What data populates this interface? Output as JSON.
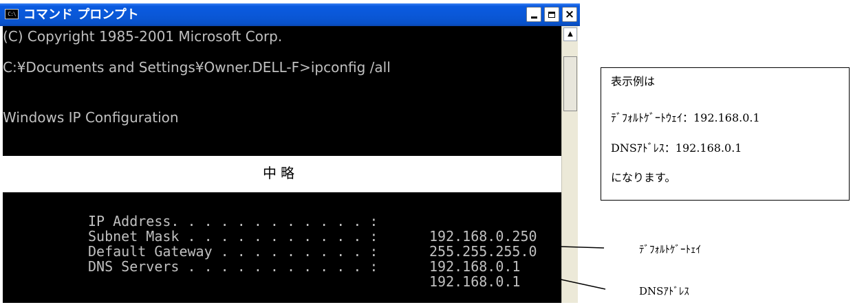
{
  "window": {
    "title": "コマンド プロンプト",
    "app_icon_text": "C:\\",
    "buttons": {
      "minimize": "minimize",
      "maximize": "maximize",
      "close": "×"
    }
  },
  "console": {
    "lines": [
      "(C) Copyright 1985-2001 Microsoft Corp.",
      "C:¥Documents and Settings¥Owner.DELL-F>ipconfig /all",
      "Windows IP Configuration"
    ],
    "omitted_label": "中略",
    "config_rows": [
      {
        "label": "IP Address. . . . . . . . . . . . :",
        "value": "192.168.0.250"
      },
      {
        "label": "Subnet Mask . . . . . . . . . . . :",
        "value": "255.255.255.0"
      },
      {
        "label": "Default Gateway . . . . . . . . . :",
        "value": "192.168.0.1"
      },
      {
        "label": "DNS Servers . . . . . . . . . . . :",
        "value": "192.168.0.1"
      }
    ]
  },
  "scrollbar": {
    "up_arrow": "▲"
  },
  "callout": {
    "lines": [
      "表示例は",
      "ﾃﾞﾌｫﾙﾄｹﾞｰﾄｳｪｲ：192.168.0.1",
      "DNSｱﾄﾞﾚｽ：192.168.0.1",
      "になります。"
    ]
  },
  "annotations": {
    "gateway_label": "ﾃﾞﾌｫﾙﾄｹﾞｰﾄｪｲ",
    "dns_label": "DNSｱﾄﾞﾚｽ"
  }
}
